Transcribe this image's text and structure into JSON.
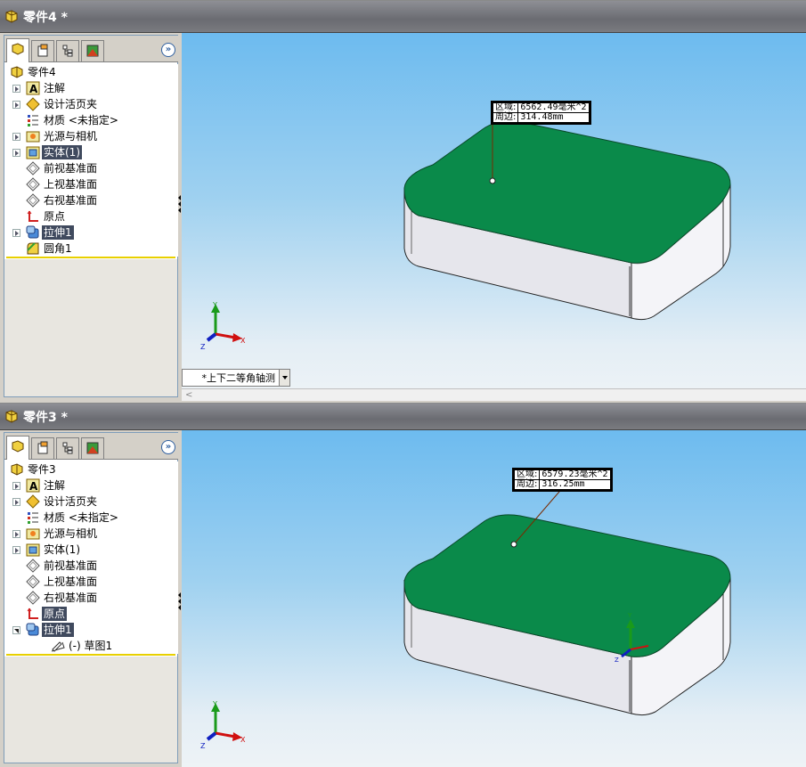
{
  "windows": [
    {
      "title": "零件4 *",
      "tree": {
        "root": "零件4",
        "items": [
          {
            "label": "注解",
            "icon": "annotation-icon",
            "expander": "collapsed",
            "selected": false
          },
          {
            "label": "设计活页夹",
            "icon": "design-binder-icon",
            "expander": "collapsed",
            "selected": false
          },
          {
            "label": "材质 <未指定>",
            "icon": "material-icon",
            "expander": "none",
            "selected": false
          },
          {
            "label": "光源与相机",
            "icon": "lights-cameras-icon",
            "expander": "collapsed",
            "selected": false
          },
          {
            "label": "实体(1)",
            "icon": "solid-bodies-icon",
            "expander": "collapsed",
            "selected": true
          },
          {
            "label": "前视基准面",
            "icon": "plane-icon",
            "expander": "none",
            "selected": false
          },
          {
            "label": "上视基准面",
            "icon": "plane-icon",
            "expander": "none",
            "selected": false
          },
          {
            "label": "右视基准面",
            "icon": "plane-icon",
            "expander": "none",
            "selected": false
          },
          {
            "label": "原点",
            "icon": "origin-icon",
            "expander": "none",
            "selected": false
          },
          {
            "label": "拉伸1",
            "icon": "extrude-icon",
            "expander": "collapsed",
            "selected": true
          },
          {
            "label": "圆角1",
            "icon": "fillet-icon",
            "expander": "none",
            "selected": false
          }
        ]
      },
      "measure": {
        "area_label": "区域:",
        "area_value": "6562.49毫米^2",
        "perimeter_label": "周边:",
        "perimeter_value": "314.48mm"
      },
      "view_orientation": "*上下二等角轴测",
      "triad": {
        "x": "X",
        "y": "Y",
        "z": "Z"
      }
    },
    {
      "title": "零件3 *",
      "tree": {
        "root": "零件3",
        "items": [
          {
            "label": "注解",
            "icon": "annotation-icon",
            "expander": "collapsed",
            "selected": false
          },
          {
            "label": "设计活页夹",
            "icon": "design-binder-icon",
            "expander": "collapsed",
            "selected": false
          },
          {
            "label": "材质 <未指定>",
            "icon": "material-icon",
            "expander": "none",
            "selected": false
          },
          {
            "label": "光源与相机",
            "icon": "lights-cameras-icon",
            "expander": "collapsed",
            "selected": false
          },
          {
            "label": "实体(1)",
            "icon": "solid-bodies-icon",
            "expander": "collapsed",
            "selected": false
          },
          {
            "label": "前视基准面",
            "icon": "plane-icon",
            "expander": "none",
            "selected": false
          },
          {
            "label": "上视基准面",
            "icon": "plane-icon",
            "expander": "none",
            "selected": false
          },
          {
            "label": "右视基准面",
            "icon": "plane-icon",
            "expander": "none",
            "selected": false
          },
          {
            "label": "原点",
            "icon": "origin-icon",
            "expander": "none",
            "selected": true
          },
          {
            "label": "拉伸1",
            "icon": "extrude-icon",
            "expander": "expanded",
            "selected": true
          },
          {
            "label": "(-) 草图1",
            "icon": "sketch-icon",
            "expander": "none",
            "selected": false,
            "child": true
          }
        ]
      },
      "measure": {
        "area_label": "区域:",
        "area_value": "6579.23毫米^2",
        "perimeter_label": "周边:",
        "perimeter_value": "316.25mm"
      },
      "triad": {
        "x": "X",
        "y": "Y",
        "z": "Z"
      }
    }
  ],
  "colors": {
    "face_selected": "#0a8a4a",
    "side_face": "#e6e6ec",
    "title_bar": "#6e6f75",
    "tree_selection": "#404a5e"
  }
}
